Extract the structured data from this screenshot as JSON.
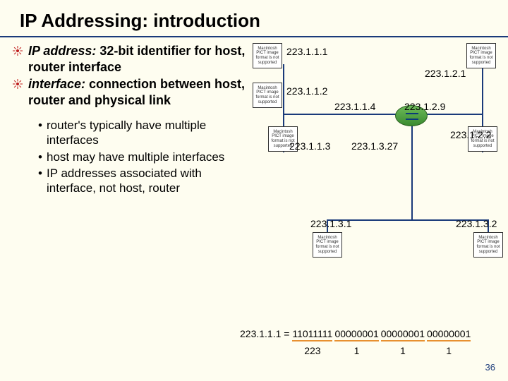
{
  "title": "IP Addressing: introduction",
  "bullets": [
    {
      "prefix": "IP address:",
      "rest": " 32-bit identifier for host, router interface"
    },
    {
      "prefix": "interface:",
      "rest": " connection between host, router and physical link"
    }
  ],
  "sub_bullets": [
    "router's typically have multiple interfaces",
    "host may have multiple interfaces",
    "IP addresses associated with interface, not host, router"
  ],
  "pict_placeholder": "Macintosh PICT image format is not supported",
  "ips": {
    "a1": "223.1.1.1",
    "a2": "223.1.1.2",
    "a3": "223.1.1.3",
    "a4": "223.1.1.4",
    "b1": "223.1.2.1",
    "b2": "223.1.2.2",
    "b9": "223.1.2.9",
    "c1": "223.1.3.1",
    "c2": "223.1.3.2",
    "c27": "223.1.3.27"
  },
  "binary": {
    "prefix": "223.1.1.1 = ",
    "groups": [
      "11011111",
      "00000001",
      "00000001",
      "00000001"
    ],
    "labels": [
      "223",
      "1",
      "1",
      "1"
    ]
  },
  "page_number": "36"
}
